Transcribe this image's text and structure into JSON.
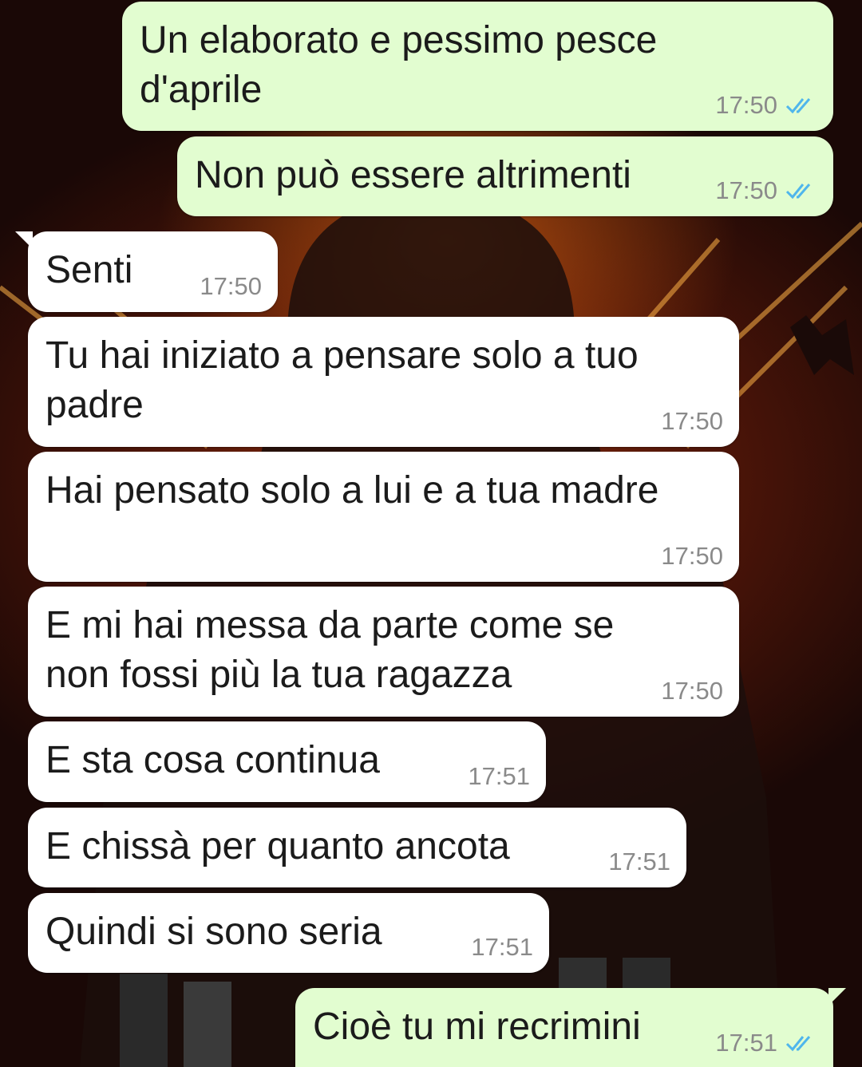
{
  "colors": {
    "outgoing_bubble": "#e2fdd0",
    "incoming_bubble": "#ffffff",
    "read_ticks": "#4fb6ec",
    "timestamp": "#8a8a8a"
  },
  "messages": [
    {
      "direction": "outgoing",
      "text_lines": [
        "Un elaborato e pessimo pesce",
        "d'aprile"
      ],
      "time": "17:50",
      "status": "read",
      "status_icon": "double-check-icon"
    },
    {
      "direction": "outgoing",
      "text_lines": [
        "Non può essere altrimenti"
      ],
      "time": "17:50",
      "status": "read",
      "status_icon": "double-check-icon"
    },
    {
      "direction": "incoming",
      "text_lines": [
        "Senti"
      ],
      "time": "17:50"
    },
    {
      "direction": "incoming",
      "text_lines": [
        "Tu hai iniziato a pensare solo a tuo",
        "padre"
      ],
      "time": "17:50"
    },
    {
      "direction": "incoming",
      "text_lines": [
        "Hai pensato solo a lui e a tua madre"
      ],
      "time": "17:50"
    },
    {
      "direction": "incoming",
      "text_lines": [
        "E mi hai messa da parte come se",
        "non fossi più la tua ragazza"
      ],
      "time": "17:50"
    },
    {
      "direction": "incoming",
      "text_lines": [
        "E sta cosa continua"
      ],
      "time": "17:51"
    },
    {
      "direction": "incoming",
      "text_lines": [
        "E chissà per quanto ancota"
      ],
      "time": "17:51"
    },
    {
      "direction": "incoming",
      "text_lines": [
        "Quindi si sono seria"
      ],
      "time": "17:51"
    },
    {
      "direction": "outgoing",
      "text_lines": [
        "Cioè tu mi recrimini"
      ],
      "time": "17:51",
      "status": "read",
      "status_icon": "double-check-icon"
    }
  ]
}
